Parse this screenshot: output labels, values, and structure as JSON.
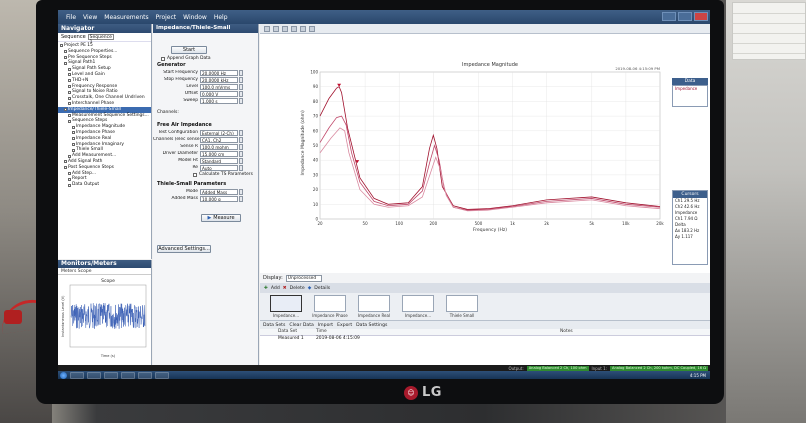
{
  "app": {
    "menu": [
      "File",
      "View",
      "Measurements",
      "Project",
      "Window",
      "Help"
    ]
  },
  "navigator": {
    "title": "Navigator",
    "sequence_label": "Sequence",
    "sequence_value": "Sequence 1",
    "tree": [
      {
        "label": "Project PE 15",
        "indent": 0
      },
      {
        "label": "Sequence Properties...",
        "indent": 1
      },
      {
        "label": "Pre Sequence Steps",
        "indent": 1
      },
      {
        "label": "Signal Path1",
        "indent": 1
      },
      {
        "label": "Signal Path Setup",
        "indent": 2
      },
      {
        "label": "Level and Gain",
        "indent": 2
      },
      {
        "label": "THD+N",
        "indent": 2
      },
      {
        "label": "Frequency Response",
        "indent": 2
      },
      {
        "label": "Signal to Noise Ratio",
        "indent": 2
      },
      {
        "label": "Crosstalk, One Channel Undriven",
        "indent": 2
      },
      {
        "label": "Interchannel Phase",
        "indent": 2
      },
      {
        "label": "Impedance/Thiele-Small",
        "indent": 1,
        "highlight": true
      },
      {
        "label": "Measurement Sequence Settings...",
        "indent": 2
      },
      {
        "label": "Sequence Steps",
        "indent": 2
      },
      {
        "label": "Impedance Magnitude",
        "indent": 3
      },
      {
        "label": "Impedance Phase",
        "indent": 3
      },
      {
        "label": "Impedance Real",
        "indent": 3
      },
      {
        "label": "Impedance Imaginary",
        "indent": 3
      },
      {
        "label": "Thiele Small",
        "indent": 3
      },
      {
        "label": "Add Measurement...",
        "indent": 2
      },
      {
        "label": "Add Signal Path",
        "indent": 1
      },
      {
        "label": "Post Sequence Steps",
        "indent": 1
      },
      {
        "label": "Add Step...",
        "indent": 2
      },
      {
        "label": "Report",
        "indent": 2
      },
      {
        "label": "Data Output",
        "indent": 2
      }
    ]
  },
  "monitors": {
    "title": "Monitors/Meters",
    "tabs": "Meters  Scope",
    "scope_title": "Scope",
    "y_label": "Instantaneous Level (V)",
    "x_label": "Time (s)"
  },
  "settings": {
    "title": "Impedance/Thiele-Small",
    "start_label": "Start",
    "append_label": "Append Graph Data",
    "generator_title": "Generator",
    "generator": [
      {
        "label": "Start Frequency",
        "value": "20.0000 Hz"
      },
      {
        "label": "Stop Frequency",
        "value": "20.0000 kHz"
      },
      {
        "label": "Level",
        "value": "100.0 mVrms"
      },
      {
        "label": "Offset",
        "value": "0.000 V"
      },
      {
        "label": "Sweep",
        "value": "1.000 s"
      }
    ],
    "channels_label": "Channels:",
    "free_air_title": "Free Air Impedance",
    "free_air": [
      {
        "label": "Test Configuration",
        "value": "External (2-Ch)"
      },
      {
        "label": "Channels (elec sense)",
        "value": "CA1, Ch2"
      },
      {
        "label": "Sense R",
        "value": "100.0 mohm"
      },
      {
        "label": "Driver Diameter",
        "value": "15.000 cm"
      },
      {
        "label": "Model Fit",
        "value": "Standard"
      },
      {
        "label": "Re",
        "value": "Auto"
      }
    ],
    "calc_ts": "Calculate TS Parameters",
    "thiele_title": "Thiele-Small Parameters",
    "thiele": [
      {
        "label": "Mode",
        "value": "Added Mass"
      },
      {
        "label": "Added Mass",
        "value": "10.000 g"
      }
    ],
    "measure_label": "Measure",
    "advanced_label": "Advanced Settings..."
  },
  "graph": {
    "title": "Impedance Magnitude",
    "timestamp": "2019-08-06 4:15:09 PM",
    "y_label": "Impedance Magnitude (ohm)",
    "x_label": "Frequency (Hz)",
    "legend_head": "Data",
    "legend_items": [
      "Impedance"
    ],
    "cursors_head": "Cursors",
    "cursor_items": [
      "Ch1  29.5 Hz",
      "Ch2  42.6 Hz",
      "Impedance",
      "Ch1  7.94 Ω",
      "Delta",
      "Δx  183.2 Hz",
      "Δy  1.117"
    ]
  },
  "chart_data": {
    "type": "line",
    "title": "Impedance Magnitude",
    "xlabel": "Frequency (Hz)",
    "ylabel": "Impedance Magnitude (ohm)",
    "x_scale": "log",
    "xlim": [
      20,
      20000
    ],
    "ylim": [
      0,
      100
    ],
    "x_ticks": [
      "20",
      "50",
      "100",
      "200",
      "500",
      "1k",
      "2k",
      "5k",
      "10k",
      "20k"
    ],
    "y_ticks": [
      "0",
      "10",
      "20",
      "30",
      "40",
      "50",
      "60",
      "70",
      "80",
      "90",
      "100"
    ],
    "grid": true,
    "series": [
      {
        "x": [
          20,
          24,
          28,
          29.5,
          31,
          35,
          45,
          60,
          80,
          120,
          160,
          185,
          200,
          215,
          240,
          300,
          400,
          600,
          1000,
          2000,
          5000,
          10000,
          20000
        ],
        "values": [
          70,
          82,
          89,
          90,
          86,
          62,
          28,
          14,
          10,
          11,
          22,
          48,
          57,
          48,
          22,
          9,
          6.5,
          7,
          9,
          13,
          15,
          11,
          8.5
        ]
      },
      {
        "x": [
          20,
          24,
          28,
          31,
          34,
          38,
          45,
          60,
          80,
          120,
          160,
          185,
          205,
          225,
          250,
          300,
          400,
          600,
          1000,
          2000,
          5000,
          10000,
          20000
        ],
        "values": [
          52,
          62,
          69,
          70,
          64,
          45,
          25,
          12,
          9,
          10,
          19,
          38,
          50,
          40,
          20,
          8,
          6,
          6.5,
          8.5,
          12,
          14,
          10,
          8
        ]
      },
      {
        "x": [
          20,
          25,
          30,
          33,
          36,
          45,
          60,
          80,
          120,
          160,
          190,
          210,
          230,
          260,
          300,
          400,
          600,
          1000,
          2000,
          5000,
          10000,
          20000
        ],
        "values": [
          45,
          55,
          62,
          60,
          45,
          20,
          10,
          8,
          9,
          15,
          32,
          42,
          34,
          16,
          8,
          5.5,
          6,
          8,
          11,
          13,
          9,
          7
        ]
      }
    ]
  },
  "display": {
    "label": "Display:",
    "value": "Unprocessed",
    "add": "Add",
    "delete": "Delete",
    "details": "Details"
  },
  "thumbs": [
    "Impedance...",
    "Impedance Phase",
    "Impedance Real",
    "Impedance...",
    "Thiele Small"
  ],
  "dataset": {
    "toolbar": [
      "Data Sets",
      "Clear Data",
      "Import",
      "Export",
      "Data Settings"
    ],
    "headers": [
      "Data Set",
      "Time",
      "Notes"
    ],
    "rows": [
      {
        "num": "1",
        "name": "Measured 1",
        "time": "2019-08-06 4:15:09",
        "notes": ""
      }
    ]
  },
  "status": {
    "output_label": "Output:",
    "output_value": "Analog Balanced 2 Ch, 100 ohm",
    "input_label": "Input 1:",
    "input_value": "Analog Balanced 2 Ch, 200 kohm, DC Coupled, 16 Ω"
  },
  "taskbar": {
    "clock": "4:15 PM"
  },
  "monitor_brand": "LG"
}
